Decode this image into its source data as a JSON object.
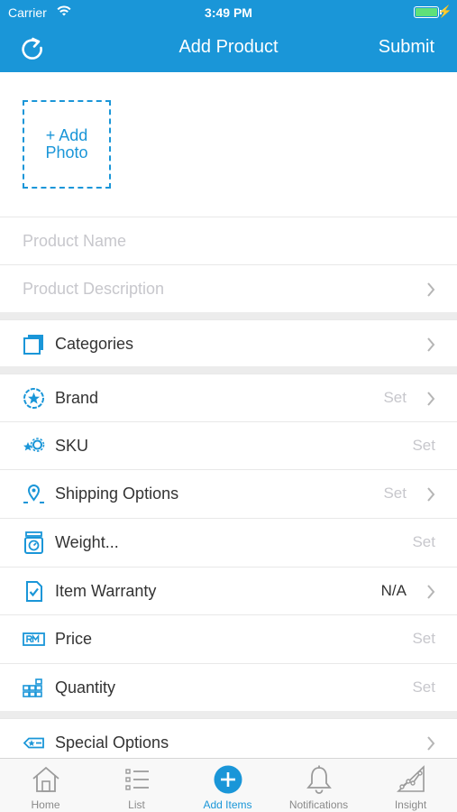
{
  "status_bar": {
    "carrier": "Carrier",
    "time": "3:49 PM",
    "battery_level": 1.0,
    "charging_glyph": "⚡"
  },
  "nav": {
    "title": "Add Product",
    "submit_label": "Submit",
    "refresh_icon": "refresh-icon"
  },
  "photo": {
    "add_line1": "+ Add",
    "add_line2": "Photo"
  },
  "fields": {
    "product_name_placeholder": "Product Name",
    "product_description_placeholder": "Product Description"
  },
  "categories": {
    "label": "Categories",
    "icon": "categories-icon"
  },
  "attributes": [
    {
      "label": "Brand",
      "value": "Set",
      "icon": "brand-badge-icon",
      "chevron": true
    },
    {
      "label": "SKU",
      "value": "Set",
      "icon": "sku-icon",
      "chevron": false
    },
    {
      "label": "Shipping Options",
      "value": "Set",
      "icon": "location-pin-icon",
      "chevron": true
    },
    {
      "label": "Weight...",
      "value": "Set",
      "icon": "weight-scale-icon",
      "chevron": false
    },
    {
      "label": "Item Warranty",
      "value": "N/A",
      "icon": "warranty-doc-icon",
      "chevron": true
    },
    {
      "label": "Price",
      "value": "Set",
      "icon": "price-rm-icon",
      "chevron": false
    },
    {
      "label": "Quantity",
      "value": "Set",
      "icon": "quantity-grid-icon",
      "chevron": false
    }
  ],
  "special_options": {
    "label": "Special Options",
    "icon": "special-options-icon"
  },
  "tabs": [
    {
      "label": "Home",
      "icon": "home-icon",
      "active": false
    },
    {
      "label": "List",
      "icon": "list-icon",
      "active": false
    },
    {
      "label": "Add Items",
      "icon": "add-circle-icon",
      "active": true
    },
    {
      "label": "Notifications",
      "icon": "bell-icon",
      "active": false
    },
    {
      "label": "Insight",
      "icon": "insight-chart-icon",
      "active": false
    }
  ],
  "colors": {
    "accent": "#1a96d8",
    "placeholder": "#c7c7cc",
    "separator": "#ececec",
    "tab_inactive": "#8a8a8a"
  }
}
